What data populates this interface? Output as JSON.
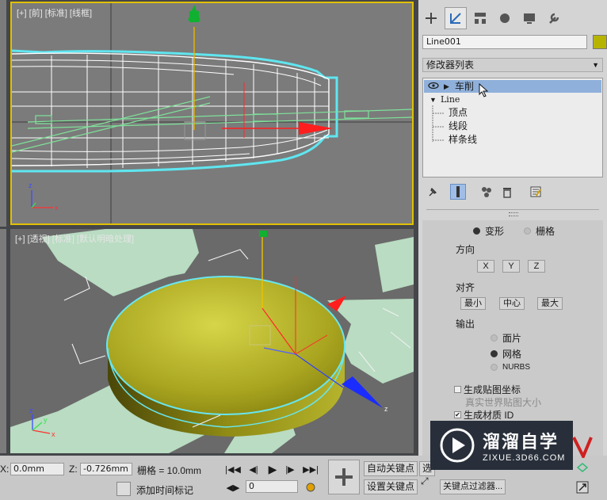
{
  "viewports": {
    "front_label": "[+] [前] [标准] [线框]",
    "persp_label": "[+] [透视] [标准] [默认明暗处理]"
  },
  "command_panel": {
    "tabs": [
      "create-icon",
      "modify-icon",
      "hierarchy-icon",
      "motion-icon",
      "display-icon",
      "utilities-icon"
    ],
    "object_name": "Line001",
    "object_color": "#b6b400",
    "modifier_list_label": "修改器列表",
    "stack": {
      "lathe": "车削",
      "line": "Line",
      "vertex": "顶点",
      "segment": "线段",
      "spline": "样条线"
    },
    "params": {
      "deform": "变形",
      "grid": "栅格",
      "direction_title": "方向",
      "x": "X",
      "y": "Y",
      "z": "Z",
      "align_title": "对齐",
      "min": "最小",
      "center": "中心",
      "max": "最大",
      "output_title": "输出",
      "patch": "面片",
      "mesh": "网格",
      "nurbs": "NURBS",
      "gen_map": "生成贴图坐标",
      "real_world": "真实世界贴图大小",
      "gen_mat": "生成材质 ID"
    }
  },
  "bottom": {
    "x_label": "X:",
    "x_value": "0.0mm",
    "z_label": "Z:",
    "z_value": "-0.726mm",
    "grid_text": "栅格 = 10.0mm",
    "add_time_tag": "添加时间标记",
    "frame_value": "0",
    "auto_key": "自动关键点",
    "set_key": "设置关键点",
    "selected": "选",
    "key_filter": "关键点过滤器..."
  },
  "watermark": {
    "brand": "溜溜自学",
    "url": "ZIXUE.3D66.COM"
  }
}
